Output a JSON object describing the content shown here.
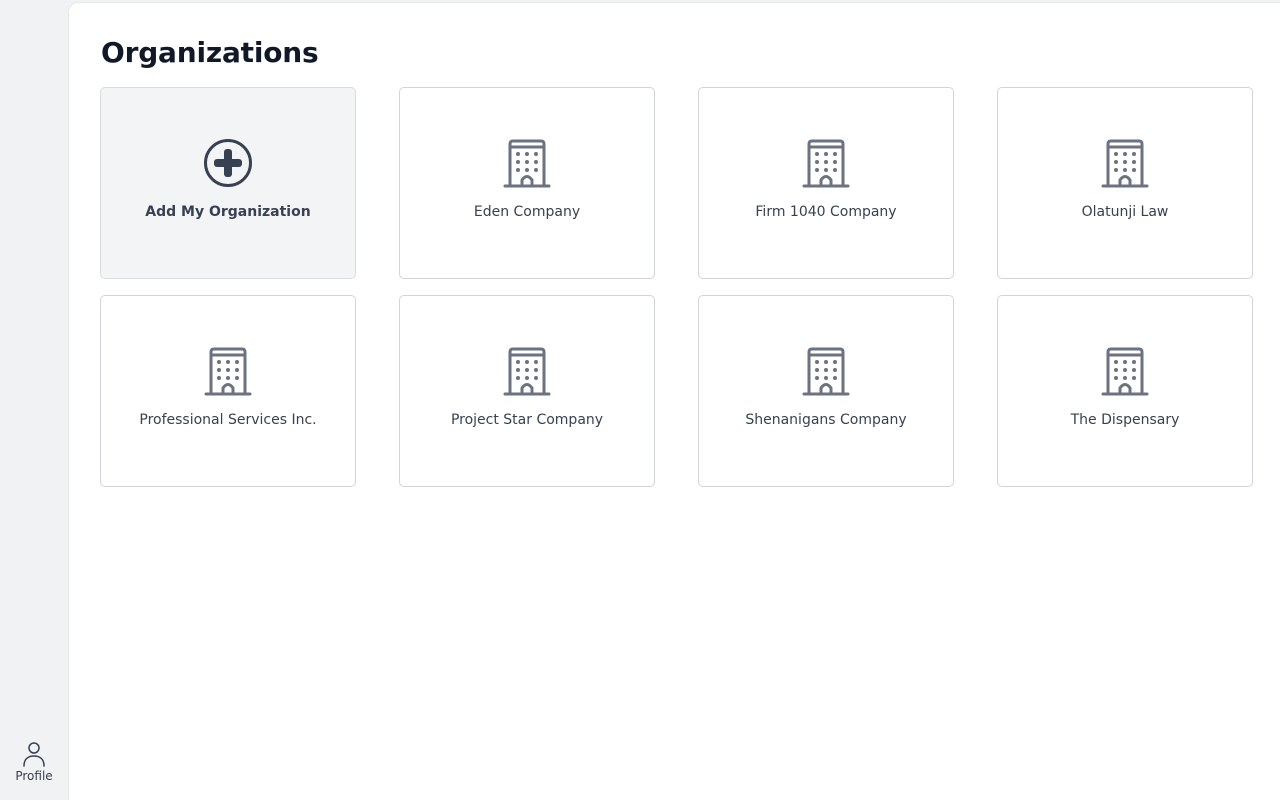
{
  "sidebar": {
    "profile_label": "Profile",
    "profile_icon": "user-icon"
  },
  "page": {
    "title": "Organizations"
  },
  "add_card": {
    "label": "Add My Organization",
    "icon": "plus-circle-icon"
  },
  "organizations": [
    {
      "name": "Eden Company",
      "icon": "building-icon"
    },
    {
      "name": "Firm 1040 Company",
      "icon": "building-icon"
    },
    {
      "name": "Olatunji Law",
      "icon": "building-icon"
    },
    {
      "name": "Professional Services Inc.",
      "icon": "building-icon"
    },
    {
      "name": "Project Star Company",
      "icon": "building-icon"
    },
    {
      "name": "Shenanigans Company",
      "icon": "building-icon"
    },
    {
      "name": "The Dispensary",
      "icon": "building-icon"
    }
  ],
  "colors": {
    "icon": "#6b7280",
    "add_icon": "#374151",
    "background": "#f1f2f4",
    "card_border": "#d1d5db"
  }
}
